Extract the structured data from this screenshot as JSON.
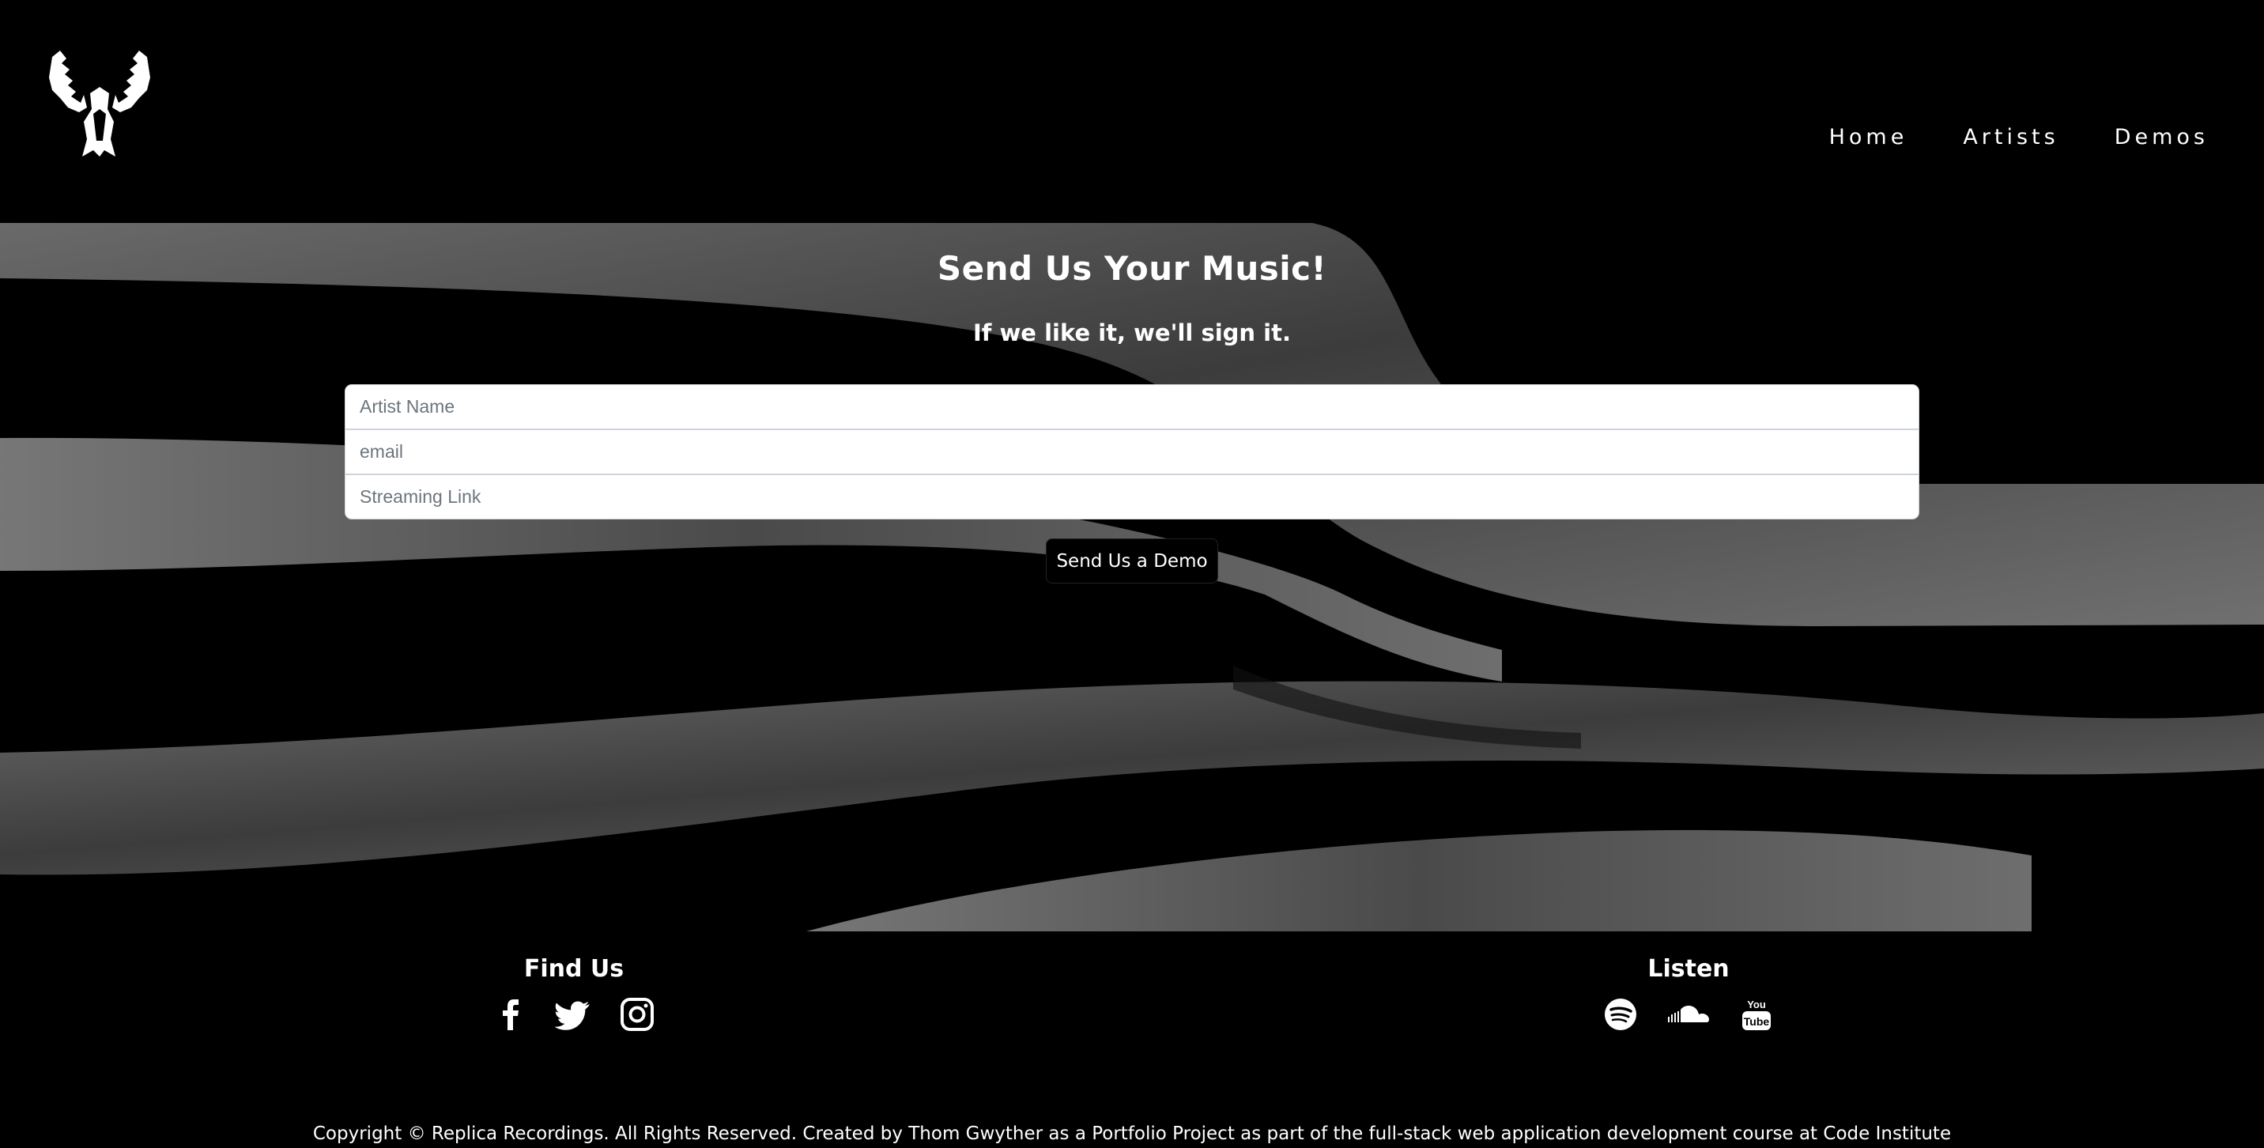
{
  "nav": {
    "items": [
      "Home",
      "Artists",
      "Demos"
    ]
  },
  "hero": {
    "title": "Send Us Your Music!",
    "subtitle": "If we like it, we'll sign it.",
    "form": {
      "artist_placeholder": "Artist Name",
      "email_placeholder": "email",
      "link_placeholder": "Streaming Link",
      "submit_label": "Send Us a Demo"
    }
  },
  "footer": {
    "find_us": {
      "heading": "Find Us",
      "icons": [
        "facebook-icon",
        "twitter-icon",
        "instagram-icon"
      ]
    },
    "listen": {
      "heading": "Listen",
      "icons": [
        "spotify-icon",
        "soundcloud-icon",
        "youtube-icon"
      ]
    },
    "copyright": "Copyright © Replica Recordings. All Rights Reserved. Created by Thom Gwyther as a Portfolio Project as part of the full-stack web application development course at Code Institute"
  },
  "colors": {
    "background": "#000000",
    "text": "#ffffff",
    "ribbon": "#5a5a5a"
  }
}
